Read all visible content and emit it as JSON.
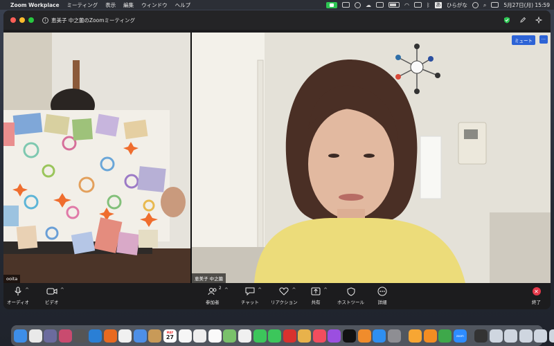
{
  "menubar": {
    "app_name": "Zoom Workplace",
    "menus": [
      "ミーティング",
      "表示",
      "編集",
      "ウィンドウ",
      "ヘルプ"
    ],
    "ime_label": "あ",
    "ime_mode": "ひらがな",
    "datetime": "5月27日(月)  15:59"
  },
  "window": {
    "meeting_title": "恵美子 中之薗のZoomミーティング"
  },
  "participants": {
    "left_name": "ooita",
    "right_name": "恵美子 中之薗",
    "mute_label": "ミュート",
    "more_label": "···"
  },
  "toolbar": {
    "audio": "オーディオ",
    "video": "ビデオ",
    "participants": "参加者",
    "participants_count": "2",
    "chat": "チャット",
    "reactions": "リアクション",
    "share": "共有",
    "host_tools": "ホストツール",
    "details": "詳細",
    "end": "終了"
  },
  "dock": {
    "calendar_day": "27",
    "calendar_month": "MAY",
    "apps": [
      "finder",
      "launchpad",
      "siri",
      "apps",
      "safari",
      "firefox",
      "chrome",
      "mail",
      "contacts",
      "calendar",
      "notes",
      "reminders",
      "freeform",
      "maps",
      "photos",
      "messages",
      "facetime",
      "pdf",
      "stocks",
      "music",
      "podcasts",
      "tv",
      "books",
      "app-store",
      "system-settings",
      "pages",
      "numbers",
      "zoom",
      "window1",
      "window2",
      "window3",
      "trash"
    ]
  },
  "colors": {
    "accent": "#2d63d6",
    "end_red": "#e5394a",
    "zoom_green": "#2dc653"
  }
}
